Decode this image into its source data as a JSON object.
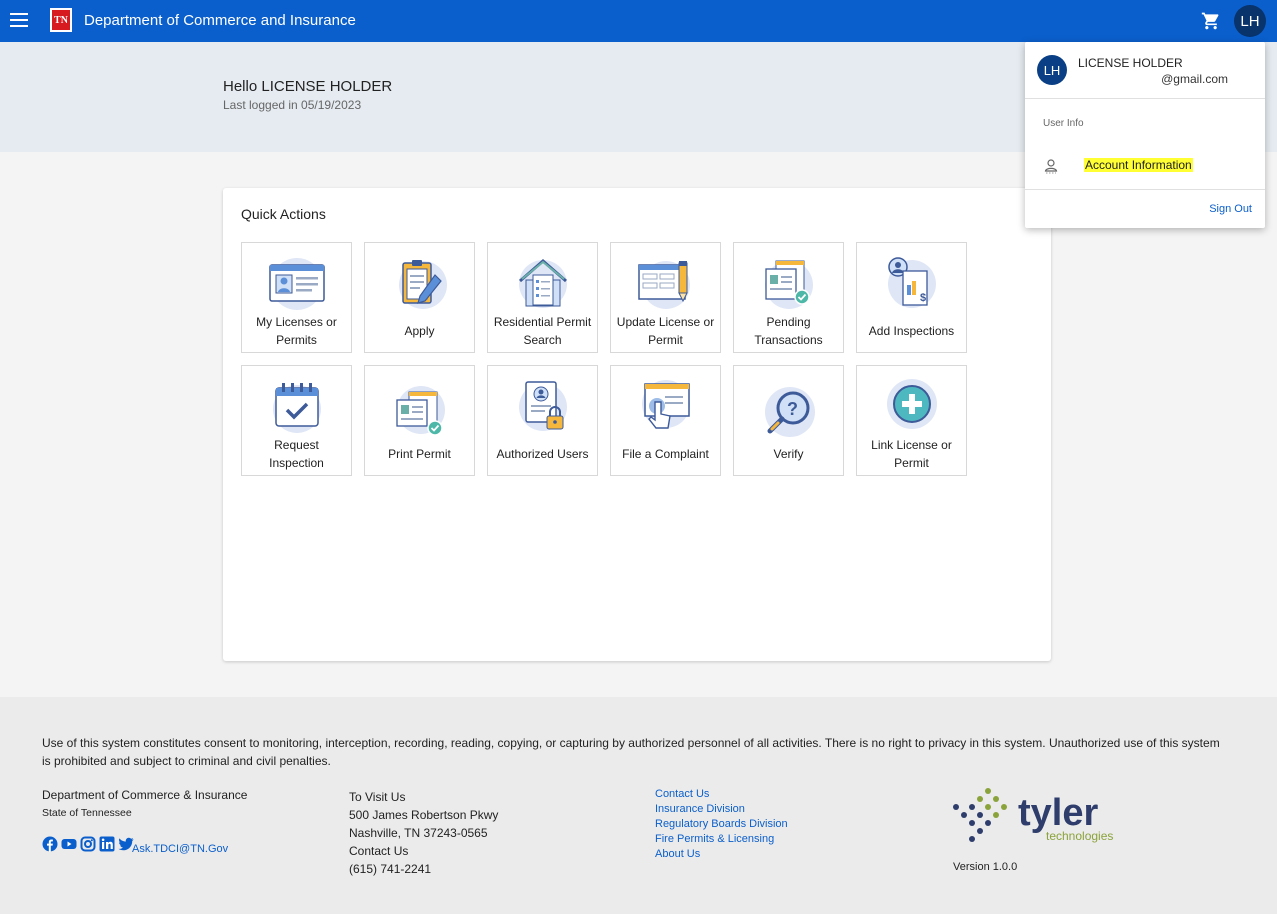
{
  "header": {
    "title": "Department of Commerce and Insurance",
    "logo_text": "TN",
    "avatar_initials": "LH"
  },
  "greeting": {
    "hello": "Hello LICENSE HOLDER",
    "last_login": "Last logged in 05/19/2023"
  },
  "quick_actions": {
    "title": "Quick Actions",
    "tiles": [
      {
        "label": "My Licenses or Permits",
        "icon": "license-card-icon"
      },
      {
        "label": "Apply",
        "icon": "clipboard-pen-icon"
      },
      {
        "label": "Residential Permit Search",
        "icon": "house-checklist-icon"
      },
      {
        "label": "Update License or Permit",
        "icon": "form-pencil-icon"
      },
      {
        "label": "Pending Transactions",
        "icon": "documents-check-icon"
      },
      {
        "label": "Add Inspections",
        "icon": "inspector-invoice-icon"
      },
      {
        "label": "Request Inspection",
        "icon": "calendar-check-icon"
      },
      {
        "label": "Print Permit",
        "icon": "print-permit-icon"
      },
      {
        "label": "Authorized Users",
        "icon": "user-lock-icon"
      },
      {
        "label": "File a Complaint",
        "icon": "hand-click-icon"
      },
      {
        "label": "Verify",
        "icon": "magnifier-question-icon"
      },
      {
        "label": "Link License or Permit",
        "icon": "plus-circle-icon"
      }
    ]
  },
  "user_menu": {
    "initials": "LH",
    "name": "LICENSE HOLDER",
    "email": "@gmail.com",
    "section_label": "User Info",
    "account_info": "Account Information",
    "sign_out": "Sign Out"
  },
  "footer": {
    "disclaimer": "Use of this system constitutes consent to monitoring, interception, recording, reading, copying, or capturing by authorized personnel of all activities. There is no right to privacy in this system. Unauthorized use of this system is prohibited and subject to criminal and civil penalties.",
    "dept": "Department of Commerce & Insurance",
    "state": "State of Tennessee",
    "email": "Ask.TDCI@TN.Gov",
    "visit": {
      "heading": "To Visit Us",
      "address1": "500 James Robertson Pkwy",
      "address2": "Nashville, TN 37243-0565",
      "contact_heading": "Contact Us",
      "phone": "(615) 741-2241"
    },
    "links": [
      "Contact Us",
      "Insurance Division",
      "Regulatory Boards Division",
      "Fire Permits & Licensing",
      "About Us"
    ],
    "logo_word": "tyler",
    "logo_sub": "technologies",
    "version": "Version 1.0.0"
  },
  "colors": {
    "header": "#0b5fcc",
    "avatar": "#08336b",
    "highlight": "#ffff33",
    "link": "#0b5fcc",
    "tyler_navy": "#2e3d6b",
    "tyler_green": "#8aa33a"
  }
}
